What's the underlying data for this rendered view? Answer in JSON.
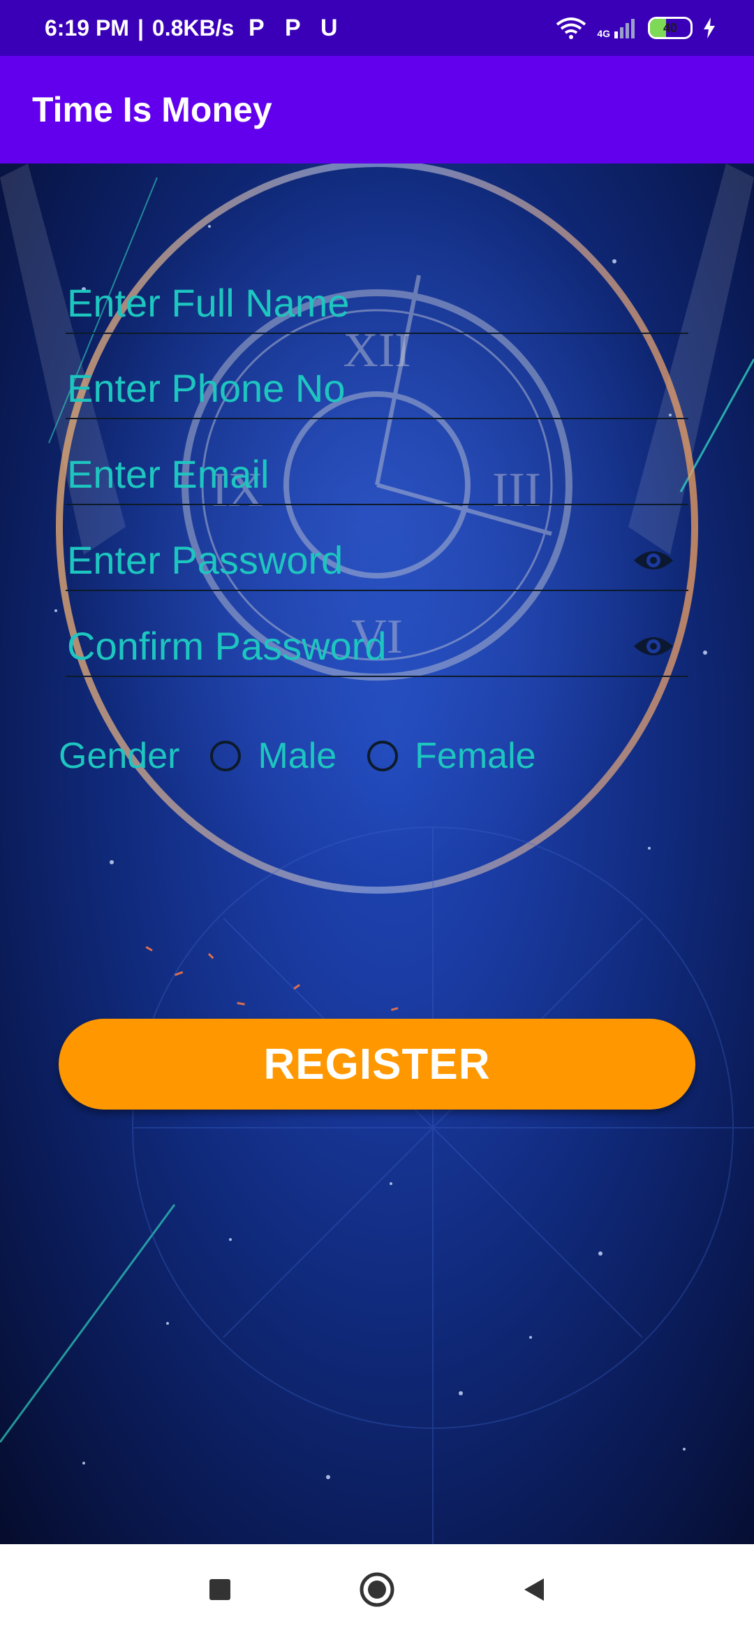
{
  "status_bar": {
    "time": "6:19 PM",
    "separator": "|",
    "net_speed": "0.8KB/s",
    "notifications": [
      "P",
      "P",
      "U"
    ],
    "network_label": "4G",
    "battery": "40"
  },
  "app_bar": {
    "title": "Time Is Money"
  },
  "form": {
    "full_name_hint": "Enter Full Name",
    "phone_hint": "Enter Phone No",
    "email_hint": "Enter Email",
    "password_hint": "Enter Password",
    "confirm_password_hint": "Confirm Password",
    "gender_label": "Gender",
    "gender_options": [
      "Male",
      "Female"
    ],
    "register_label": "REGISTER"
  },
  "colors": {
    "status_bar": "#3a00b8",
    "app_bar": "#6200ee",
    "hint_text": "#1ec6c0",
    "register_button": "#ff9800"
  }
}
